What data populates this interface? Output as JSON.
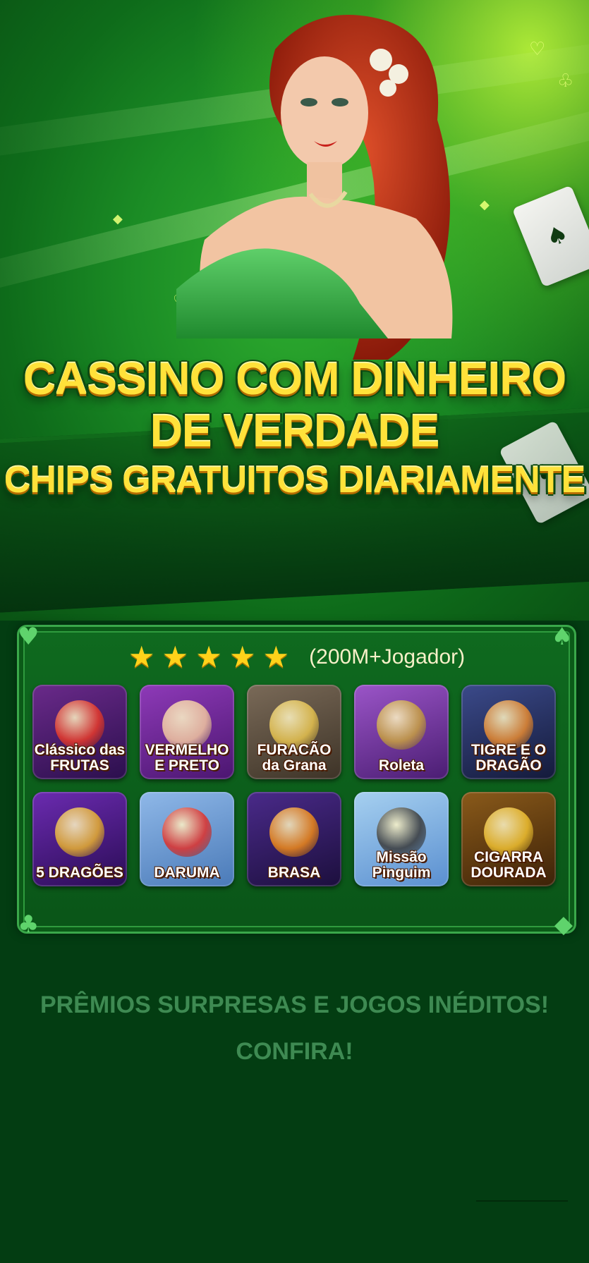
{
  "hero": {
    "headline_line1": "CASSINO COM DINHEIRO",
    "headline_line2": "DE VERDADE",
    "headline_line3": "CHIPS GRATUITOS DIARIAMENTE",
    "card_suit": "♠"
  },
  "games_panel": {
    "star_count": 5,
    "rating_text": "(200M+Jogador)",
    "corner_icons": [
      "heart-icon",
      "spade-icon",
      "club-icon",
      "diamond-icon"
    ],
    "games": [
      {
        "label": "Clássico das FRUTAS",
        "color_a": "#6a2a8a",
        "color_b": "#2b0f4d",
        "art": "#e83a2a"
      },
      {
        "label": "VERMELHO E PRETO",
        "color_a": "#8e3ab8",
        "color_b": "#4b1670",
        "art": "#f2c6a0"
      },
      {
        "label": "FURACÃO da Grana",
        "color_a": "#7a6a58",
        "color_b": "#3d3327",
        "art": "#e8c450"
      },
      {
        "label": "Roleta",
        "color_a": "#9b55c8",
        "color_b": "#4a1d72",
        "art": "#c8a040"
      },
      {
        "label": "TIGRE E O DRAGÃO",
        "color_a": "#3b4a8a",
        "color_b": "#141a3a",
        "art": "#e88a30"
      },
      {
        "label": "5 DRAGÕES",
        "color_a": "#6b2bb0",
        "color_b": "#2a0c55",
        "art": "#e8b030"
      },
      {
        "label": "DARUMA",
        "color_a": "#8fb8e8",
        "color_b": "#4a7ab8",
        "art": "#e0302a"
      },
      {
        "label": "BRASA",
        "color_a": "#4a2a8a",
        "color_b": "#1c0f3d",
        "art": "#f08a1a"
      },
      {
        "label": "Missão Pinguim",
        "color_a": "#a6d0f0",
        "color_b": "#5a8fd0",
        "art": "#3a3a3a"
      },
      {
        "label": "CIGARRA DOURADA",
        "color_a": "#8a5a1a",
        "color_b": "#3d2208",
        "art": "#f0c030"
      }
    ]
  },
  "promo": {
    "line1": "PRÊMIOS SURPRESAS E JOGOS INÉDITOS!",
    "line2": "CONFIRA!"
  }
}
